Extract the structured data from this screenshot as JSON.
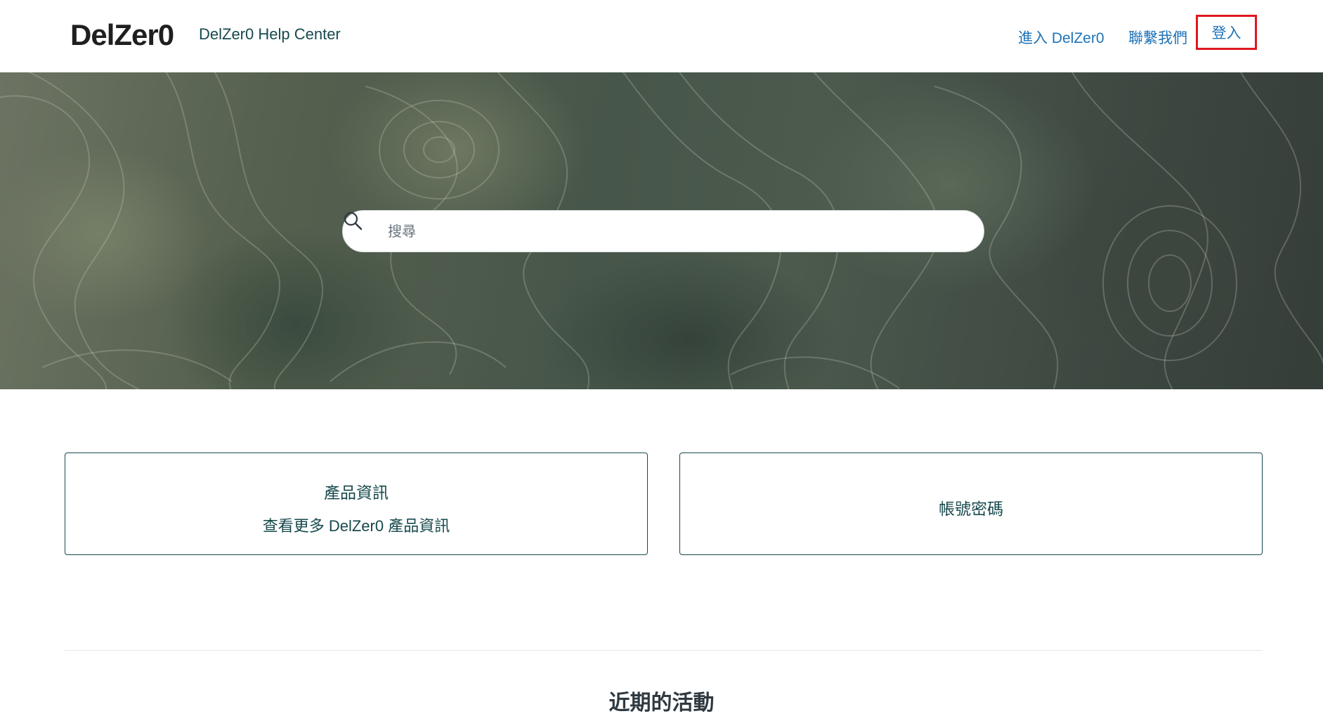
{
  "header": {
    "logo": "DelZer0",
    "site_name": "DelZer0 Help Center",
    "nav": {
      "enter_label": "進入 DelZer0",
      "contact_label": "聯繫我們",
      "signin_label": "登入"
    }
  },
  "hero": {
    "search": {
      "placeholder": "搜尋",
      "value": ""
    }
  },
  "categories": [
    {
      "title": "產品資訊",
      "description": "查看更多 DelZer0 產品資訊"
    },
    {
      "title": "帳號密碼"
    }
  ],
  "recent_activity": {
    "title": "近期的活動"
  },
  "colors": {
    "link": "#1f73b7",
    "brand_text": "#17494d",
    "highlight": "#e0161f"
  }
}
